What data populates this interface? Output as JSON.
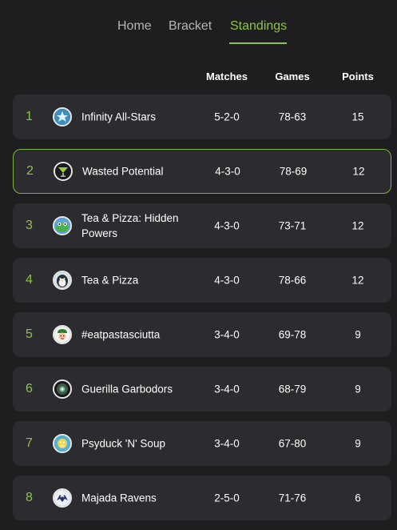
{
  "nav": {
    "tabs": [
      {
        "label": "Home",
        "active": false
      },
      {
        "label": "Bracket",
        "active": false
      },
      {
        "label": "Standings",
        "active": true
      }
    ],
    "accent_color": "#8bc34a"
  },
  "table": {
    "headers": {
      "matches": "Matches",
      "games": "Games",
      "points": "Points"
    },
    "rows": [
      {
        "rank": "1",
        "team": "Infinity All-Stars",
        "matches": "5-2-0",
        "games": "78-63",
        "points": "15",
        "icon": "all-stars-logo-icon",
        "highlighted": false
      },
      {
        "rank": "2",
        "team": "Wasted Potential",
        "matches": "4-3-0",
        "games": "78-69",
        "points": "12",
        "icon": "cocktail-logo-icon",
        "highlighted": true
      },
      {
        "rank": "3",
        "team": "Tea & Pizza: Hidden Powers",
        "matches": "4-3-0",
        "games": "73-71",
        "points": "12",
        "icon": "frog-logo-icon",
        "highlighted": false
      },
      {
        "rank": "4",
        "team": "Tea & Pizza",
        "matches": "4-3-0",
        "games": "78-66",
        "points": "12",
        "icon": "penguin-logo-icon",
        "highlighted": false
      },
      {
        "rank": "5",
        "team": "#eatpastasciutta",
        "matches": "3-4-0",
        "games": "69-78",
        "points": "9",
        "icon": "chef-logo-icon",
        "highlighted": false
      },
      {
        "rank": "6",
        "team": "Guerilla Garbodors",
        "matches": "3-4-0",
        "games": "68-79",
        "points": "9",
        "icon": "garbodor-logo-icon",
        "highlighted": false
      },
      {
        "rank": "7",
        "team": "Psyduck 'N' Soup",
        "matches": "3-4-0",
        "games": "67-80",
        "points": "9",
        "icon": "psyduck-logo-icon",
        "highlighted": false
      },
      {
        "rank": "8",
        "team": "Majada Ravens",
        "matches": "2-5-0",
        "games": "71-76",
        "points": "6",
        "icon": "raven-logo-icon",
        "highlighted": false
      }
    ]
  }
}
